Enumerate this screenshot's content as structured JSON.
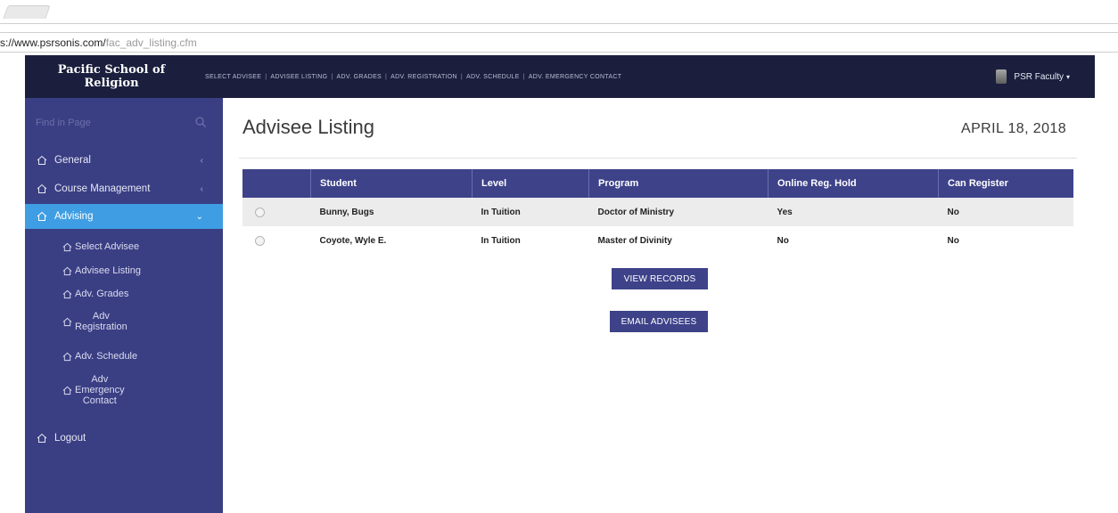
{
  "browser": {
    "url_host": "s://www.psrsonis.com/",
    "url_path": "fac_adv_listing.cfm"
  },
  "header": {
    "brand_line1": "Pacific School of",
    "brand_line2": "Religion",
    "nav": [
      "SELECT ADVISEE",
      "ADVISEE LISTING",
      "ADV. GRADES",
      "ADV. REGISTRATION",
      "ADV. SCHEDULE",
      "ADV. EMERGENCY CONTACT"
    ],
    "nav_separator": "|",
    "user_label": "PSR Faculty",
    "user_caret": "▾"
  },
  "sidebar": {
    "search_placeholder": "Find in Page",
    "items": [
      {
        "label": "General",
        "chevron": "‹"
      },
      {
        "label": "Course Management",
        "chevron": "‹"
      },
      {
        "label": "Advising",
        "chevron": "⌄"
      }
    ],
    "sub_items": [
      {
        "lines": [
          "Select Advisee"
        ]
      },
      {
        "lines": [
          "Advisee Listing"
        ]
      },
      {
        "lines": [
          "Adv. Grades"
        ]
      },
      {
        "lines": [
          "Adv",
          "Registration"
        ]
      },
      {
        "lines": [
          "Adv. Schedule"
        ]
      },
      {
        "lines": [
          "Adv",
          "Emergency",
          "Contact"
        ]
      }
    ],
    "logout_label": "Logout"
  },
  "main": {
    "title": "Advisee Listing",
    "date": "APRIL 18, 2018",
    "table": {
      "columns": [
        "",
        "Student",
        "Level",
        "Program",
        "Online Reg. Hold",
        "Can Register"
      ],
      "rows": [
        [
          "Bunny, Bugs",
          "In Tuition",
          "Doctor of Ministry",
          "Yes",
          "No"
        ],
        [
          "Coyote, Wyle E.",
          "In Tuition",
          "Master of Divinity",
          "No",
          "No"
        ]
      ]
    },
    "view_records_label": "VIEW RECORDS",
    "email_advisees_label": "EMAIL ADVISEES"
  },
  "colors": {
    "header_bg": "#1b1f3d",
    "sidebar_bg": "#3a3f84",
    "active_item": "#3f9ee3",
    "table_header": "#3d4289",
    "button_bg": "#3d4289"
  },
  "icons": [
    "home-icon",
    "search-icon",
    "chevron-left-icon",
    "chevron-down-icon",
    "avatar"
  ]
}
